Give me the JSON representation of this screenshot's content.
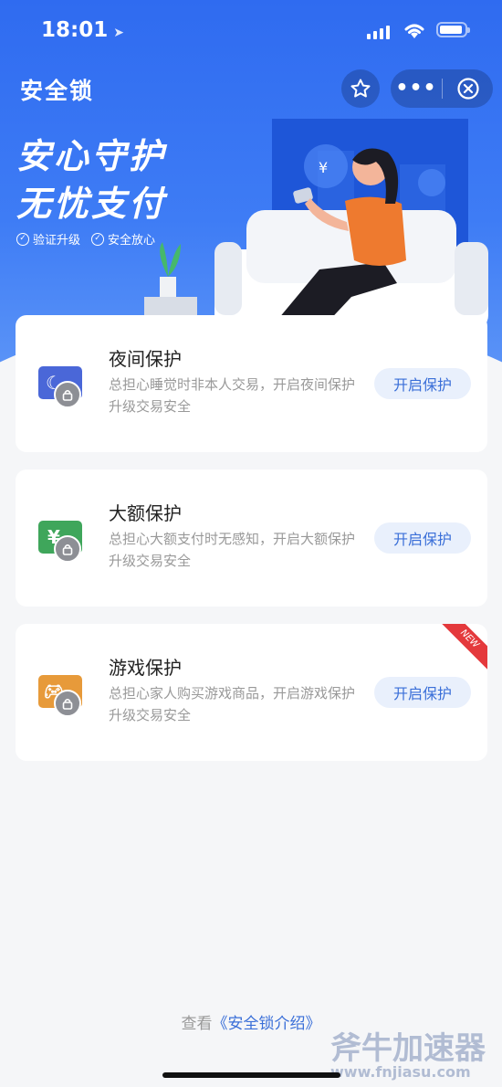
{
  "status_bar": {
    "time": "18:01"
  },
  "nav": {
    "title": "安全锁"
  },
  "hero": {
    "slogan_line1": "安心守护",
    "slogan_line2": "无忧支付",
    "tags": [
      "验证升级",
      "安全放心"
    ]
  },
  "cards": [
    {
      "title": "夜间保护",
      "desc": "总担心睡觉时非本人交易，开启夜间保护升级交易安全",
      "button": "开启保护",
      "icon": "moon-icon",
      "color": "#4a67d8"
    },
    {
      "title": "大额保护",
      "desc": "总担心大额支付时无感知，开启大额保护升级交易安全",
      "button": "开启保护",
      "icon": "yuan-icon",
      "color": "#3fa65b"
    },
    {
      "title": "游戏保护",
      "desc": "总担心家人购买游戏商品，开启游戏保护升级交易安全",
      "button": "开启保护",
      "icon": "gamepad-icon",
      "color": "#e79a3a",
      "badge": "NEW"
    }
  ],
  "footer": {
    "prefix": "查看",
    "link": "《安全锁介绍》"
  },
  "watermark": {
    "name": "斧牛加速器",
    "url": "www.fnjiasu.com"
  },
  "colors": {
    "primary": "#2f6bf0",
    "button_text": "#3a6fd8",
    "button_bg": "#e9f0fc"
  }
}
